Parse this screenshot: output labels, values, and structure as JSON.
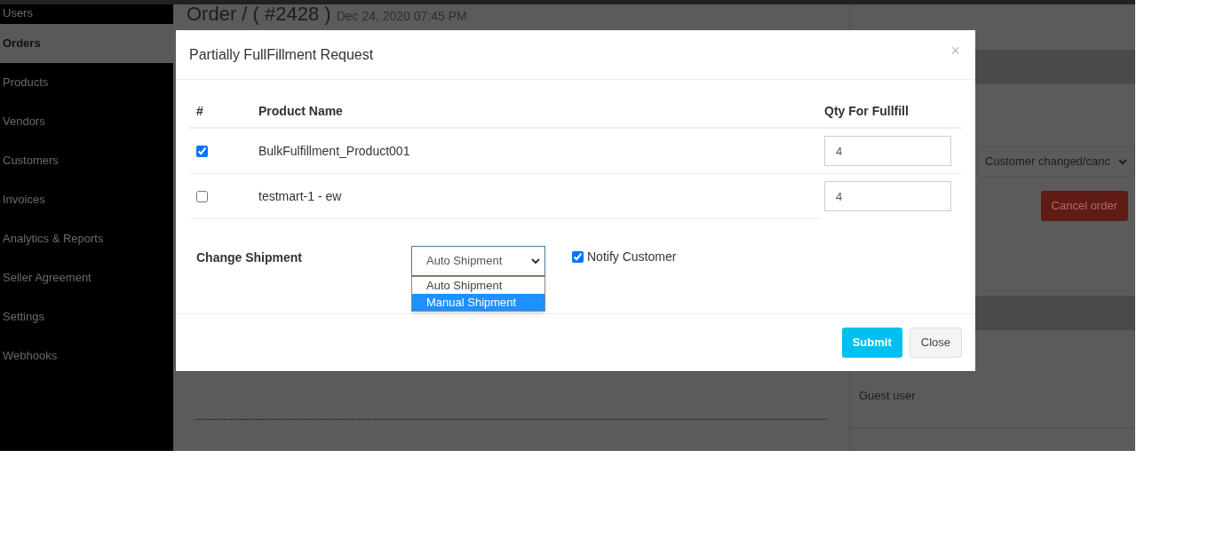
{
  "sidebar": {
    "items": [
      {
        "label": "Users",
        "selected": false
      },
      {
        "label": "Orders",
        "selected": true
      },
      {
        "label": "Products",
        "selected": false
      },
      {
        "label": "Vendors",
        "selected": false
      },
      {
        "label": "Customers",
        "selected": false
      },
      {
        "label": "Invoices",
        "selected": false
      },
      {
        "label": "Analytics & Reports",
        "selected": false
      },
      {
        "label": "Seller Agreement",
        "selected": false
      },
      {
        "label": "Settings",
        "selected": false
      },
      {
        "label": "Webhooks",
        "selected": false
      }
    ]
  },
  "page": {
    "title": "Order / ( #2428 )",
    "date": "Dec 24, 2020 07:45 PM",
    "cancel_reason": "Customer changed/canc",
    "cancel_button": "Cancel order",
    "customer": "Guest user"
  },
  "modal": {
    "title": "Partially FullFillment Request",
    "close": "×",
    "columns": [
      "#",
      "Product Name",
      "Qty For Fullfill"
    ],
    "rows": [
      {
        "checked": true,
        "product": "BulkFulfillment_Product001",
        "qty": "4"
      },
      {
        "checked": false,
        "product": "testmart-1 - ew",
        "qty": "4"
      }
    ],
    "shipment": {
      "label": "Change Shipment",
      "value": "Auto Shipment",
      "options": [
        {
          "label": "Auto Shipment",
          "highlighted": false
        },
        {
          "label": "Manual Shipment",
          "highlighted": true
        }
      ]
    },
    "notify": {
      "label": "Notify Customer",
      "checked": true
    },
    "buttons": [
      "Submit",
      "Close"
    ]
  }
}
